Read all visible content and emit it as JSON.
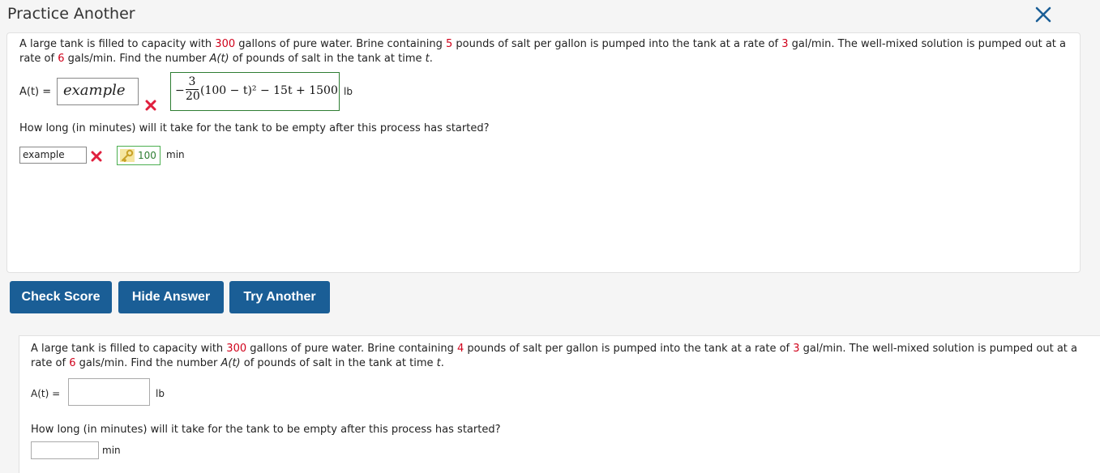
{
  "header": {
    "title": "Practice Another"
  },
  "problem1": {
    "text": {
      "p1": "A large tank is filled to capacity with ",
      "capacity": "300",
      "p2": " gallons of pure water. Brine containing ",
      "salt": "5",
      "p3": " pounds of salt per gallon is pumped into the tank at a rate of ",
      "rate_in": "3",
      "p4": " gal/min. The well-mixed solution is pumped out at a rate of ",
      "rate_out": "6",
      "p5": " gals/min. Find the number ",
      "func": "A(t)",
      "p6": " of pounds of salt in the tank at time ",
      "var": "t",
      "p7": "."
    },
    "at_label": "A(t) =",
    "student_answer": "example",
    "correct_answer": {
      "sign": "−",
      "frac_num": "3",
      "frac_den": "20",
      "rest": "(100 − t)² − 15t + 1500"
    },
    "unit": "lb",
    "q2_text": "How long (in minutes) will it take for the tank to be empty after this process has started?",
    "student_answer2": "example",
    "correct_answer2": "100",
    "unit2": "min"
  },
  "buttons": {
    "check_score": "Check Score",
    "hide_answer": "Hide Answer",
    "try_another": "Try Another"
  },
  "problem2": {
    "text": {
      "p1": "A large tank is filled to capacity with ",
      "capacity": "300",
      "p2": " gallons of pure water. Brine containing ",
      "salt": "4",
      "p3": " pounds of salt per gallon is pumped into the tank at a rate of ",
      "rate_in": "3",
      "p4": " gal/min. The well-mixed solution is pumped out at a rate of ",
      "rate_out": "6",
      "p5": " gals/min. Find the number ",
      "func": "A(t)",
      "p6": " of pounds of salt in the tank at time ",
      "var": "t",
      "p7": "."
    },
    "at_label": "A(t) =",
    "input_value": "",
    "unit": "lb",
    "q2_text": "How long (in minutes) will it take for the tank to be empty after this process has started?",
    "input2_value": "",
    "unit2": "min"
  },
  "colors": {
    "highlight": "#d0021b",
    "button": "#1a5e96",
    "correct_border": "#2e7d32"
  }
}
